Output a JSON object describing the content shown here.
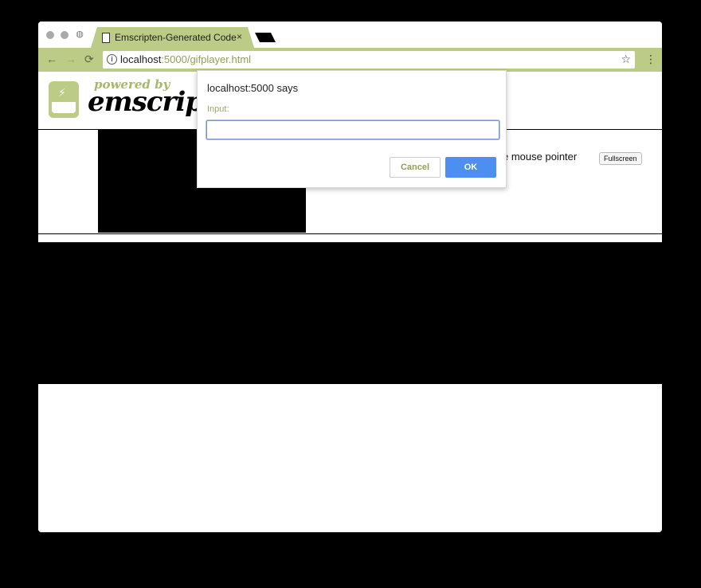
{
  "browser": {
    "tab_title": "Emscripten-Generated Code",
    "tab_close": "×",
    "url_host": "localhost",
    "url_rest": ":5000/gifplayer.html",
    "icons": {
      "back": "←",
      "forward": "→",
      "reload": "⟳",
      "star": "☆",
      "menu": "⋮",
      "info": "i",
      "globe": "◍"
    },
    "accent_color": "#bccb85"
  },
  "page": {
    "logo_powered": "powered by",
    "logo_brand": "emscripten",
    "lock_pointer_text": "e mouse pointer",
    "fullscreen_label": "Fullscreen"
  },
  "dialog": {
    "title": "localhost:5000 says",
    "input_label": "Input:",
    "input_value": "",
    "cancel_label": "Cancel",
    "ok_label": "OK"
  }
}
